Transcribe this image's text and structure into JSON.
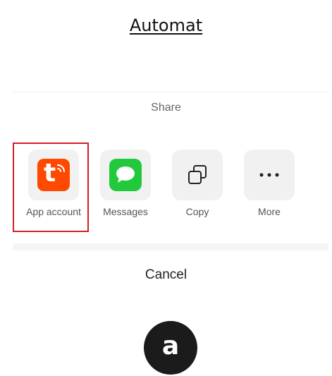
{
  "header": {
    "title": "Automat"
  },
  "share_sheet": {
    "label": "Share",
    "apps": [
      {
        "label": "App account",
        "icon": "tuya-smart-app-icon",
        "color": "#ff4800",
        "selected": true
      },
      {
        "label": "Messages",
        "icon": "messages-icon",
        "color": "#22c93c"
      },
      {
        "label": "Copy",
        "icon": "copy-icon"
      },
      {
        "label": "More",
        "icon": "more-dots-icon"
      }
    ],
    "cancel_label": "Cancel",
    "logo_letter": "t"
  },
  "badge": {
    "text": "a"
  },
  "colors": {
    "selection": "#d11d2a",
    "tile": "#f1f1f1"
  }
}
